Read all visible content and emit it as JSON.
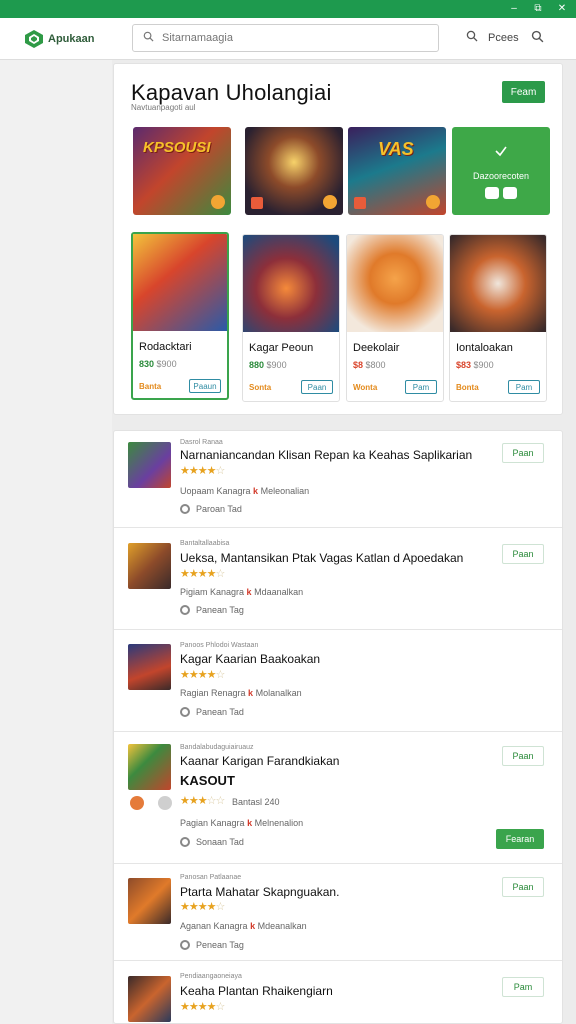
{
  "window": {
    "controls": [
      "–",
      "⧉",
      "✕"
    ]
  },
  "header": {
    "logo_text": "Apukaan",
    "search_placeholder": "Sitarnamaagia",
    "search_button_label": "Pcees"
  },
  "featured": {
    "title": "Kapavan Uholangiai",
    "subtitle": "Navtuanpagoti aul",
    "action_label": "Feam",
    "thumbs": [
      {
        "label": "KPSOUSI"
      },
      {
        "label": ""
      },
      {
        "label": "VAS"
      },
      {
        "label": "Dazoorecoten"
      }
    ],
    "cards": [
      {
        "name": "Rodacktari",
        "price": "830",
        "price2": "$900",
        "meta": "Banta",
        "button": "Paaun"
      },
      {
        "name": "Kagar Peoun",
        "price": "880",
        "price2": "$900",
        "meta": "Sonta",
        "button": "Paan"
      },
      {
        "name": "Deekolair",
        "price": "$8",
        "price2": "$800",
        "meta": "Wonta",
        "button": "Pam"
      },
      {
        "name": "Iontaloakan",
        "price": "$83",
        "price2": "$900",
        "meta": "Bonta",
        "button": "Pam"
      }
    ]
  },
  "list": [
    {
      "tag": "Dasrol Ranaa",
      "title": "Narnaniancandan Klisan Repan ka Keahas Saplikarian",
      "stars": 4,
      "meta_left": "Uopaam Kanagra ",
      "meta_mid": "k",
      "meta_right": "Meleonalian",
      "foot": "Paroan  Tad",
      "button": "Paan"
    },
    {
      "tag": "Bantaltallaabisa",
      "title": "Ueksa, Mantansikan Ptak Vagas Katlan d Apoedakan",
      "stars": 4,
      "meta_left": "Pigiam Kanagra ",
      "meta_mid": "k",
      "meta_right": "Mdaanalkan",
      "foot": "Panean  Tag",
      "button": "Paan"
    },
    {
      "tag": "Panoos Phlodoi Wastaan",
      "title": "Kagar Kaarian Baakoakan",
      "stars": 4,
      "meta_left": "Ragian Renagra ",
      "meta_mid": "k",
      "meta_right": "Molanalkan",
      "foot": "Panean  Tad",
      "button": ""
    },
    {
      "tag": "Bandalabudaguiairuauz",
      "title": "Kaanar Karigan Farandkiakan",
      "title2": "KASOUT",
      "stars": 3,
      "rating_text": "Bantasl 240",
      "meta_left": "Pagian Kanagra ",
      "meta_mid": "k",
      "meta_right": "Melnenalion",
      "foot": "Sonaan  Tad",
      "button": "Paan",
      "button2": "Fearan"
    },
    {
      "tag": "Panosan Patlaanae",
      "title": "Ptarta Mahatar Skapnguakan.",
      "stars": 4,
      "meta_left": "Aganan Kanagra ",
      "meta_mid": "k",
      "meta_right": "Mdeanalkan",
      "foot": "Penean  Tag",
      "button": "Paan"
    },
    {
      "tag": "Pendiaangaoneiaya",
      "title": "Keaha Plantan Rhaikengiarn",
      "stars": 4,
      "meta_left": "",
      "meta_mid": "",
      "meta_right": "",
      "foot": "",
      "button": "Pam"
    }
  ],
  "colors": {
    "brand": "#1e9a4e",
    "accent": "#3aa44c",
    "star": "#e7a21f"
  }
}
